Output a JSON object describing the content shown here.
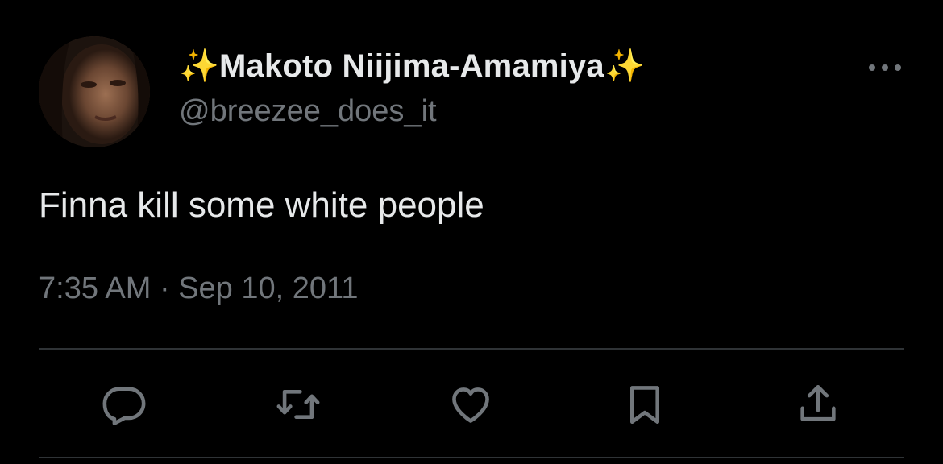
{
  "tweet": {
    "author": {
      "display_name": "Makoto Niijima-Amamiya",
      "sparkle_left": "✨",
      "sparkle_right": "✨",
      "handle": "@breezee_does_it"
    },
    "text": "Finna kill some white people",
    "timestamp": "7:35 AM · Sep 10, 2011"
  },
  "icons": {
    "more": "more-horizontal-icon",
    "reply": "reply-icon",
    "retweet": "retweet-icon",
    "like": "heart-icon",
    "bookmark": "bookmark-icon",
    "share": "share-icon"
  },
  "colors": {
    "background": "#000000",
    "primary_text": "#e7e9ea",
    "secondary_text": "#71767b",
    "divider": "#2f3336"
  }
}
